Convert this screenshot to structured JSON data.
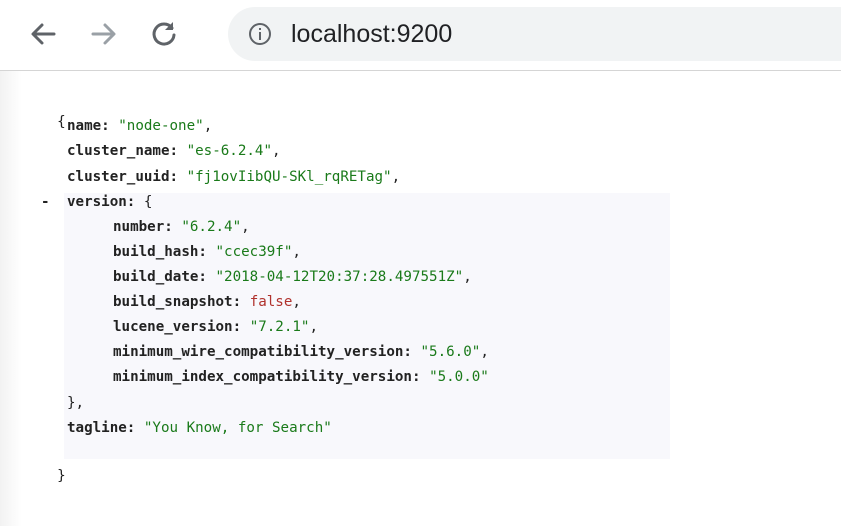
{
  "browser": {
    "url": "localhost:9200",
    "icons": {
      "back": "back-arrow-icon",
      "forward": "forward-arrow-icon",
      "reload": "reload-icon",
      "info": "info-icon"
    }
  },
  "json_view": {
    "open_brace": "{",
    "close_brace": "}",
    "collapse_toggle": "-",
    "name_key": "name",
    "name_value": "\"node-one\"",
    "cluster_name_key": "cluster_name",
    "cluster_name_value": "\"es-6.2.4\"",
    "cluster_uuid_key": "cluster_uuid",
    "cluster_uuid_value": "\"fj1ovIibQU-SKl_rqRETag\"",
    "version_key": "version",
    "version_open": "{",
    "version_close": "},",
    "version": {
      "number_key": "number",
      "number_value": "\"6.2.4\"",
      "build_hash_key": "build_hash",
      "build_hash_value": "\"ccec39f\"",
      "build_date_key": "build_date",
      "build_date_value": "\"2018-04-12T20:37:28.497551Z\"",
      "build_snapshot_key": "build_snapshot",
      "build_snapshot_value": "false",
      "lucene_version_key": "lucene_version",
      "lucene_version_value": "\"7.2.1\"",
      "min_wire_key": "minimum_wire_compatibility_version",
      "min_wire_value": "\"5.6.0\"",
      "min_index_key": "minimum_index_compatibility_version",
      "min_index_value": "\"5.0.0\""
    },
    "tagline_key": "tagline",
    "tagline_value": "\"You Know, for Search\""
  },
  "colors": {
    "string": "#1a7a1a",
    "boolean": "#b0322d",
    "key": "#222222",
    "omnibox_bg": "#f1f3f4",
    "block_highlight": "#f8f8fc"
  }
}
